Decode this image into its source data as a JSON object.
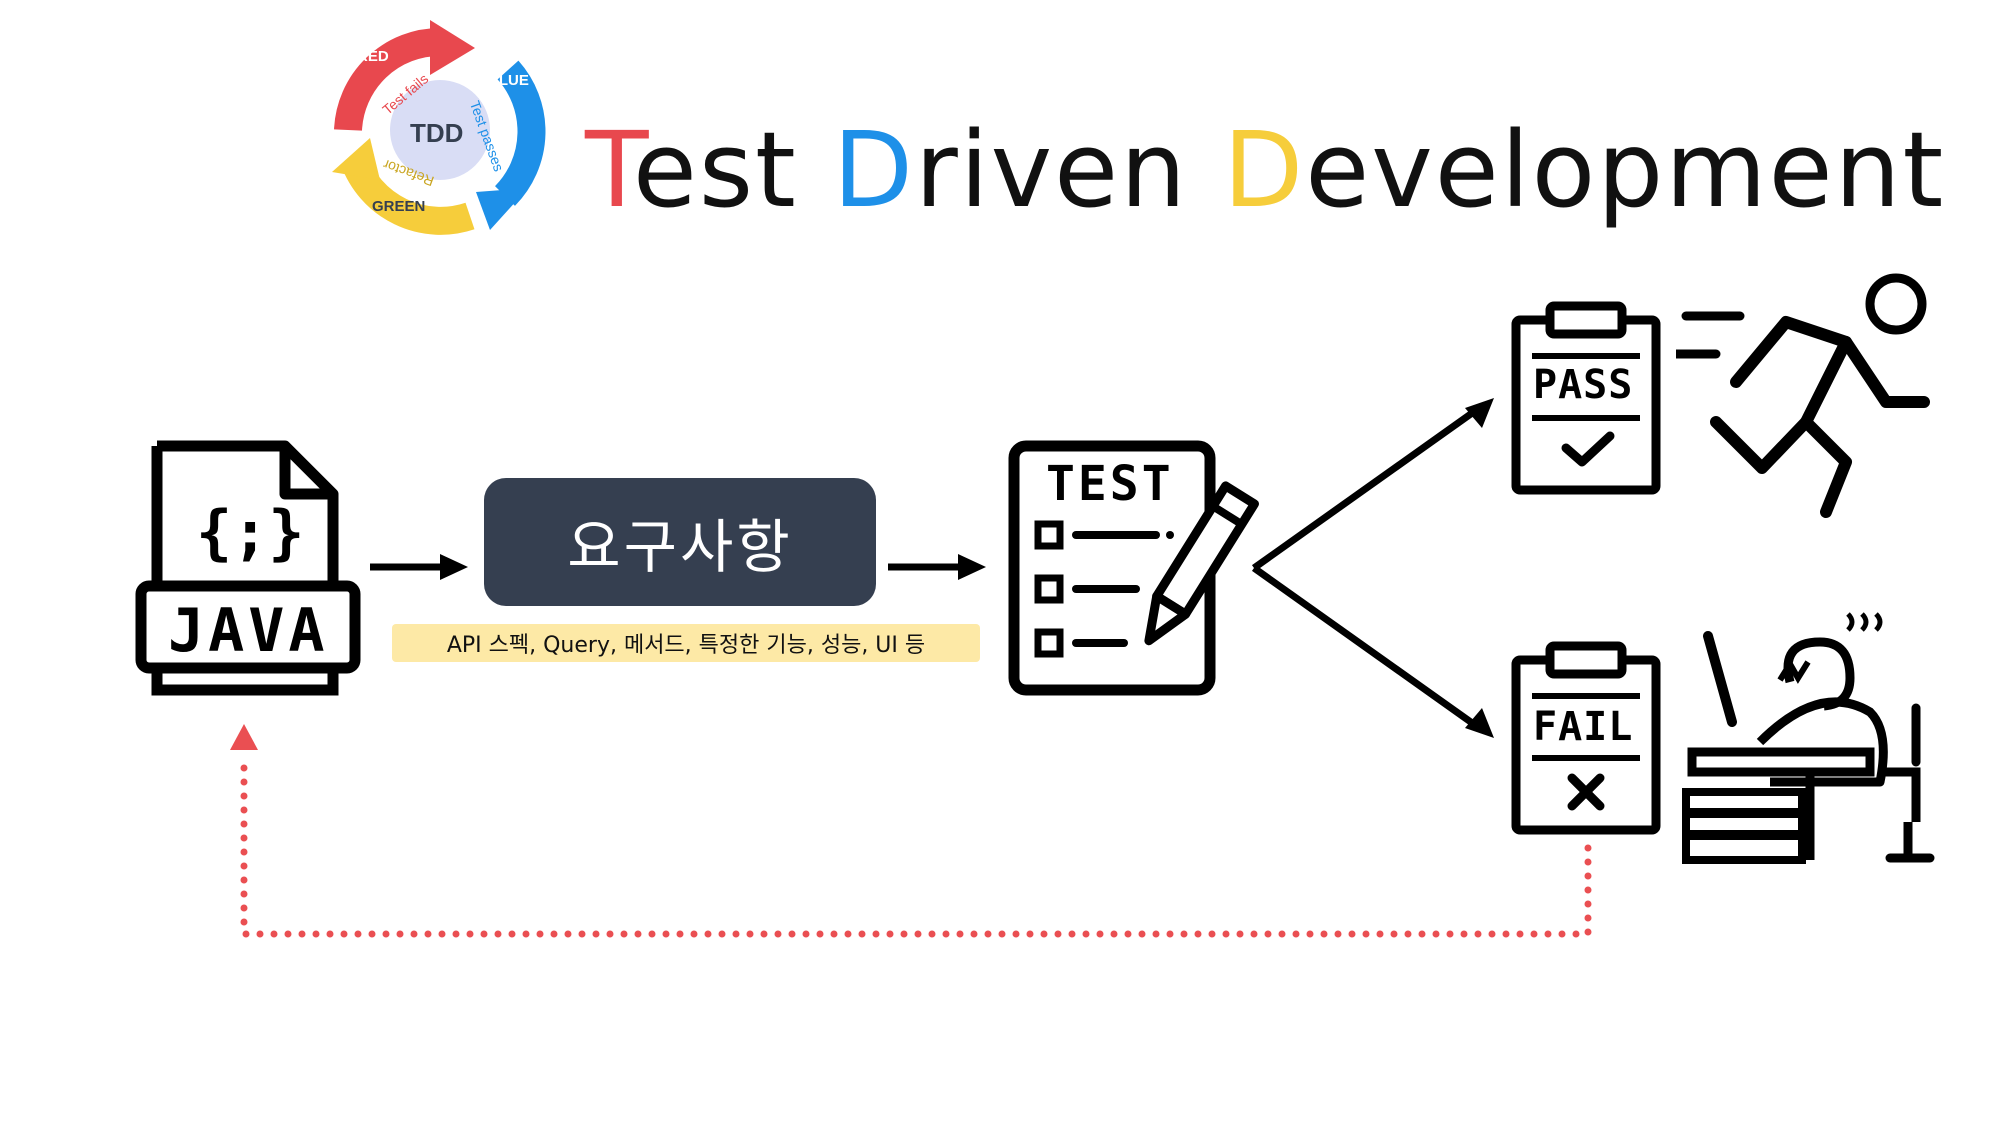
{
  "title": {
    "letters": [
      {
        "text": "T",
        "color": "#e8484e"
      },
      {
        "text": "est ",
        "color": "#111111"
      },
      {
        "text": "D",
        "color": "#1e90e8"
      },
      {
        "text": "riven ",
        "color": "#111111"
      },
      {
        "text": "D",
        "color": "#f6cd3b"
      },
      {
        "text": "evelopment",
        "color": "#111111"
      }
    ]
  },
  "tdd_logo": {
    "center": "TDD",
    "red_label": "RED",
    "blue_label": "BLUE",
    "green_label": "GREEN",
    "test_fails": "Test fails",
    "test_passes": "Test passes",
    "refactor": "Refactor"
  },
  "java_icon": {
    "brace_text": "{;}",
    "label": "JAVA"
  },
  "requirements": {
    "label": "요구사항",
    "note": "API 스펙, Query, 메서드, 특정한 기능, 성능, UI 등"
  },
  "test_sheet": {
    "label": "TEST"
  },
  "pass_board": {
    "label": "PASS"
  },
  "fail_board": {
    "label": "FAIL"
  },
  "colors": {
    "red": "#e8484e",
    "blue": "#1e90e8",
    "yellow": "#f6cd3b",
    "dark_box": "#353f50",
    "note_bg": "#fde9a6",
    "loop_dots": "#ea4f52"
  },
  "icons": [
    "tdd-cycle-icon",
    "java-file-icon",
    "test-checklist-icon",
    "pencil-icon",
    "pass-clipboard-icon",
    "running-person-icon",
    "fail-clipboard-icon",
    "stressed-person-icon"
  ]
}
